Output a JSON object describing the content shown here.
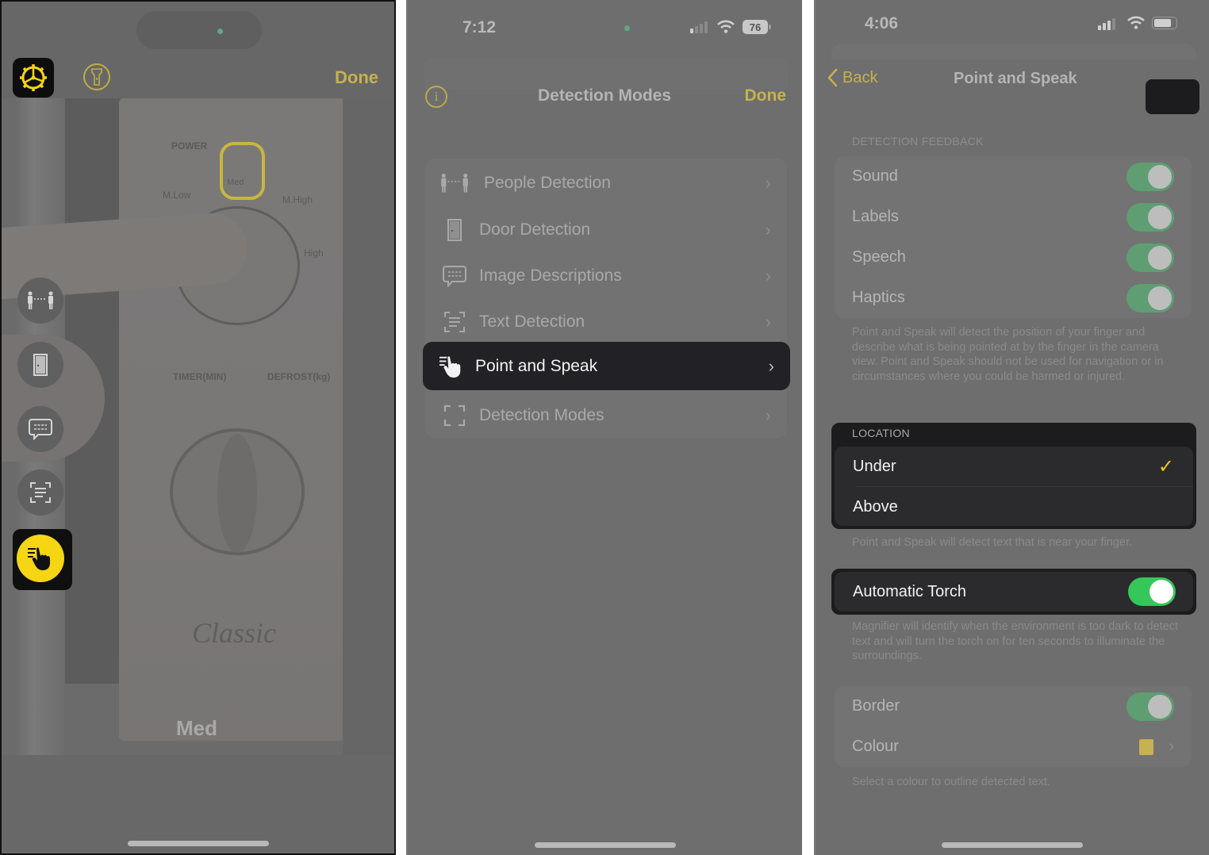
{
  "phone1": {
    "header": {
      "done_label": "Done"
    },
    "icons": {
      "settings": "gear-icon",
      "torch": "flashlight-icon"
    },
    "modes": [
      {
        "name": "people-detection",
        "icon": "people-icon",
        "active": false
      },
      {
        "name": "door-detection",
        "icon": "door-icon",
        "active": false
      },
      {
        "name": "image-descriptions",
        "icon": "speech-bubble-icon",
        "active": false
      },
      {
        "name": "text-detection",
        "icon": "text-scan-icon",
        "active": false
      },
      {
        "name": "point-and-speak",
        "icon": "pointing-hand-icon",
        "active": true
      }
    ],
    "camera_text": {
      "power": "POWER",
      "m_low": "M.Low",
      "med": "Med",
      "m_high": "M.High",
      "high": "High",
      "timer": "TIMER(MIN)",
      "defrost": "DEFROST(kg)",
      "brand": "Classic"
    },
    "detected_text": "Med",
    "colors": {
      "accent": "#c7b24c",
      "active_mode": "#f5d514"
    }
  },
  "phone2": {
    "status": {
      "time": "7:12",
      "battery": "76"
    },
    "header": {
      "title": "Detection Modes",
      "done_label": "Done"
    },
    "items": [
      {
        "label": "People Detection",
        "icon": "people-icon",
        "selected": false
      },
      {
        "label": "Door Detection",
        "icon": "door-icon",
        "selected": false
      },
      {
        "label": "Image Descriptions",
        "icon": "speech-bubble-icon",
        "selected": false
      },
      {
        "label": "Text Detection",
        "icon": "text-scan-icon",
        "selected": false
      },
      {
        "label": "Point and Speak",
        "icon": "pointing-hand-icon",
        "selected": true
      },
      {
        "label": "Detection Modes",
        "icon": "viewfinder-icon",
        "selected": false
      }
    ]
  },
  "phone3": {
    "status": {
      "time": "4:06"
    },
    "header": {
      "back_label": "Back",
      "title": "Point and Speak"
    },
    "detection_feedback": {
      "header": "DETECTION FEEDBACK",
      "items": [
        {
          "label": "Sound",
          "on": true
        },
        {
          "label": "Labels",
          "on": true
        },
        {
          "label": "Speech",
          "on": true
        },
        {
          "label": "Haptics",
          "on": true
        }
      ],
      "footer": "Point and Speak will detect the position of your finger and describe what is being pointed at by the finger in the camera view. Point and Speak should not be used for navigation or in circumstances where you could be harmed or injured."
    },
    "location": {
      "header": "LOCATION",
      "options": [
        {
          "label": "Under",
          "selected": true
        },
        {
          "label": "Above",
          "selected": false
        }
      ],
      "footer": "Point and Speak will detect text that is near your finger."
    },
    "automatic_torch": {
      "label": "Automatic Torch",
      "on": true,
      "footer": "Magnifier will identify when the environment is too dark to detect text and will turn the torch on for ten seconds to illuminate the surroundings."
    },
    "border_section": {
      "items": [
        {
          "label": "Border",
          "on": true
        },
        {
          "label": "Colour",
          "value_color": "#c7b251"
        }
      ],
      "footer": "Select a colour to outline detected text."
    },
    "colors": {
      "accent": "#c5b14e",
      "checkmark": "#f2c61c",
      "switch_on": "#35c759"
    }
  }
}
